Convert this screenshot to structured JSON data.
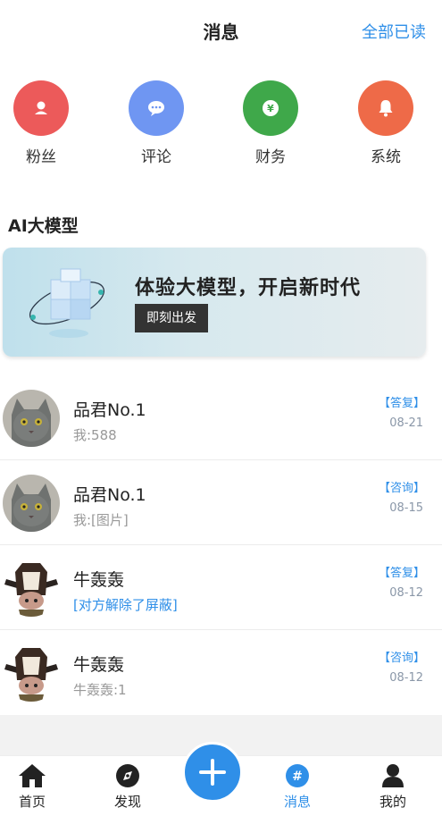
{
  "header": {
    "title": "消息",
    "read_all": "全部已读"
  },
  "categories": [
    {
      "label": "粉丝",
      "icon": "fans-icon",
      "color": "#ec5a5a"
    },
    {
      "label": "评论",
      "icon": "comment-icon",
      "color": "#6f96f2"
    },
    {
      "label": "财务",
      "icon": "finance-icon",
      "color": "#3fa84a"
    },
    {
      "label": "系统",
      "icon": "system-icon",
      "color": "#ee6a48"
    }
  ],
  "ai": {
    "section_title": "AI大模型",
    "headline": "体验大模型，开启新时代",
    "button": "即刻出发"
  },
  "messages": [
    {
      "name": "品君No.1",
      "preview": "我:588",
      "tag": "【答复】",
      "date": "08-21",
      "avatar": "cat-avatar"
    },
    {
      "name": "品君No.1",
      "preview": "我:[图片]",
      "tag": "【咨询】",
      "date": "08-15",
      "avatar": "cat-avatar"
    },
    {
      "name": "牛轰轰",
      "preview": "[对方解除了屏蔽]",
      "tag": "【答复】",
      "date": "08-12",
      "avatar": "cow-avatar"
    },
    {
      "name": "牛轰轰",
      "preview": "牛轰轰:1",
      "tag": "【咨询】",
      "date": "08-12",
      "avatar": "cow-avatar"
    }
  ],
  "nav": [
    {
      "label": "首页",
      "icon": "home-icon"
    },
    {
      "label": "发现",
      "icon": "compass-icon"
    },
    {
      "label": "消息",
      "icon": "message-icon",
      "active": true
    },
    {
      "label": "我的",
      "icon": "user-icon"
    }
  ],
  "fab": {
    "icon": "plus-icon"
  }
}
